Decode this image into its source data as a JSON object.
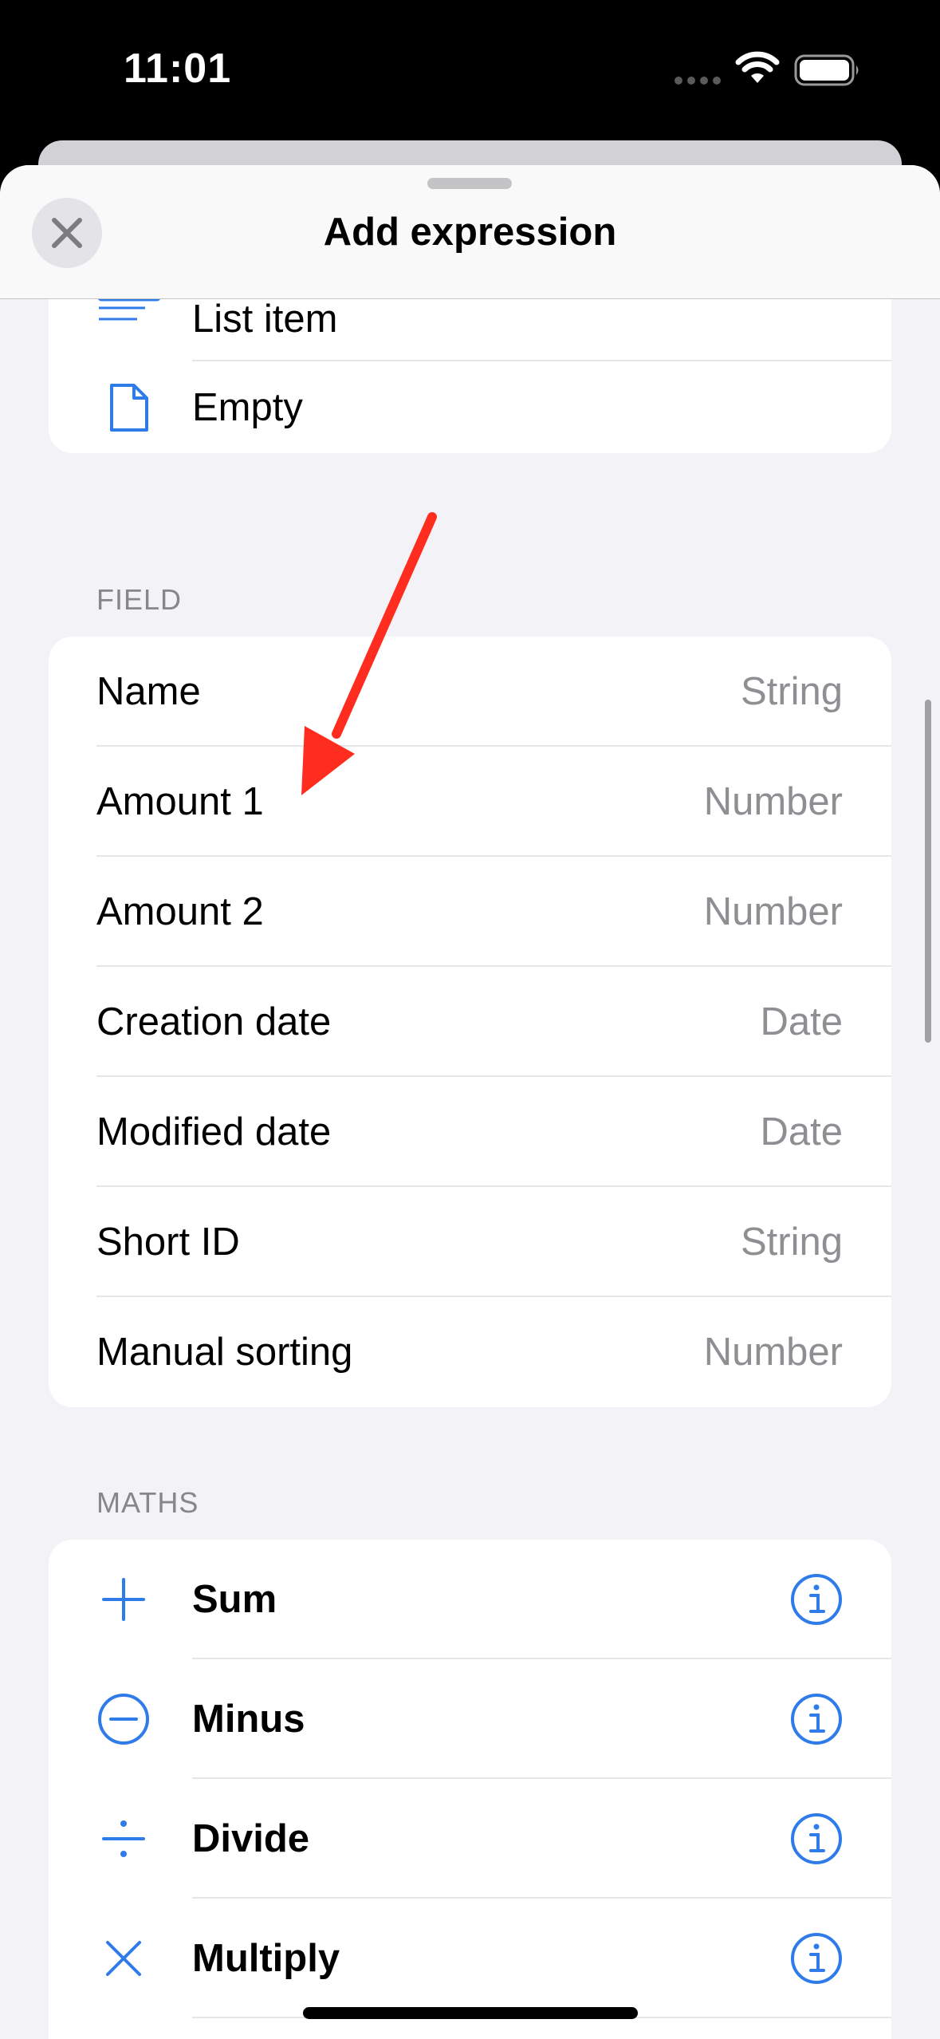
{
  "status": {
    "time": "11:01"
  },
  "sheet": {
    "title": "Add expression",
    "close_icon": "xmark-icon"
  },
  "templates": {
    "items": [
      {
        "label": "List item",
        "icon": "list-item-icon"
      },
      {
        "label": "Empty",
        "icon": "document-icon"
      }
    ]
  },
  "field_section": {
    "header": "FIELD",
    "items": [
      {
        "label": "Name",
        "type": "String"
      },
      {
        "label": "Amount 1",
        "type": "Number"
      },
      {
        "label": "Amount 2",
        "type": "Number"
      },
      {
        "label": "Creation date",
        "type": "Date"
      },
      {
        "label": "Modified date",
        "type": "Date"
      },
      {
        "label": "Short ID",
        "type": "String"
      },
      {
        "label": "Manual sorting",
        "type": "Number"
      }
    ]
  },
  "maths_section": {
    "header": "MATHS",
    "items": [
      {
        "label": "Sum",
        "icon": "plus-icon"
      },
      {
        "label": "Minus",
        "icon": "minus-circle-icon"
      },
      {
        "label": "Divide",
        "icon": "divide-icon"
      },
      {
        "label": "Multiply",
        "icon": "multiply-icon"
      }
    ]
  },
  "colors": {
    "accent": "#2f7bea",
    "annotation_arrow": "#ff2d1f"
  }
}
